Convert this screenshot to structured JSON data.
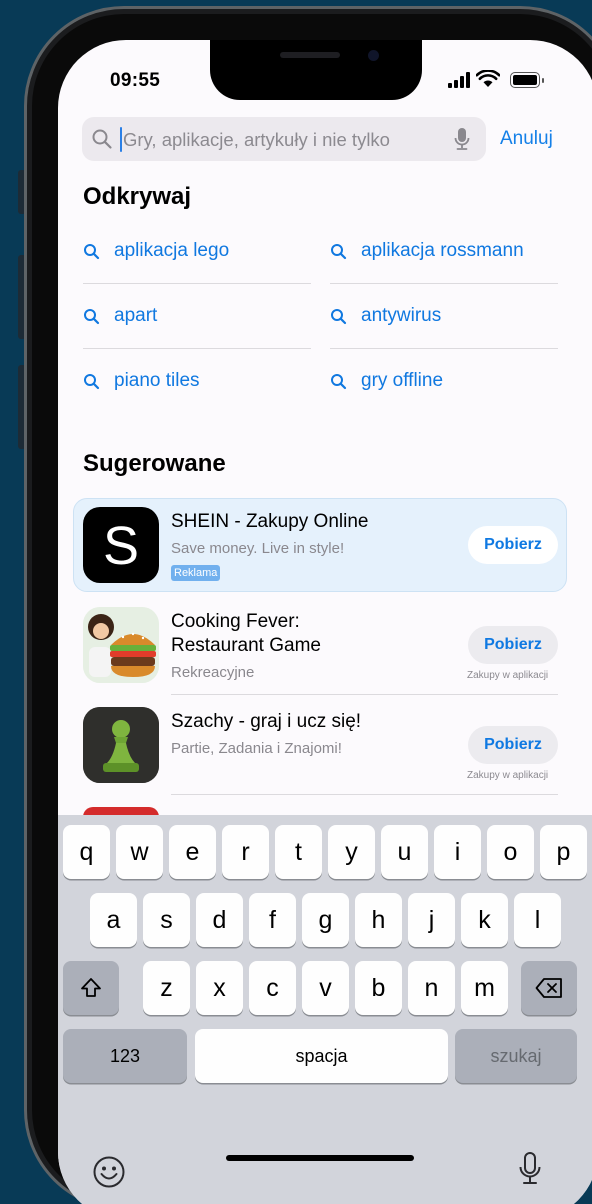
{
  "status_bar": {
    "time": "09:55"
  },
  "search": {
    "placeholder": "Gry, aplikacje, artykuły i nie tylko",
    "cancel_label": "Anuluj"
  },
  "discover": {
    "title": "Odkrywaj",
    "items": [
      {
        "label": "aplikacja lego"
      },
      {
        "label": "aplikacja rossmann"
      },
      {
        "label": "apart"
      },
      {
        "label": "antywirus"
      },
      {
        "label": "piano tiles"
      },
      {
        "label": "gry offline"
      }
    ]
  },
  "suggested": {
    "title": "Sugerowane",
    "apps": [
      {
        "name": "SHEIN - Zakupy Online",
        "subtitle": "Save money. Live in style!",
        "badge": "Reklama",
        "button": "Pobierz",
        "icon": "shein-logo-icon"
      },
      {
        "name_line1": "Cooking Fever:",
        "name_line2": "Restaurant Game",
        "subtitle": "Rekreacyjne",
        "button": "Pobierz",
        "note": "Zakupy w aplikacji",
        "icon": "burger-chef-icon"
      },
      {
        "name": "Szachy - graj i ucz się!",
        "subtitle": "Partie, Zadania i Znajomi!",
        "button": "Pobierz",
        "note": "Zakupy w aplikacji",
        "icon": "chess-pawn-icon"
      }
    ]
  },
  "keyboard": {
    "row1": [
      "q",
      "w",
      "e",
      "r",
      "t",
      "y",
      "u",
      "i",
      "o",
      "p"
    ],
    "row2": [
      "a",
      "s",
      "d",
      "f",
      "g",
      "h",
      "j",
      "k",
      "l"
    ],
    "row3": [
      "z",
      "x",
      "c",
      "v",
      "b",
      "n",
      "m"
    ],
    "numbers_label": "123",
    "space_label": "spacja",
    "search_label": "szukaj"
  },
  "colors": {
    "accent": "#1078e0",
    "background": "#083a56"
  }
}
